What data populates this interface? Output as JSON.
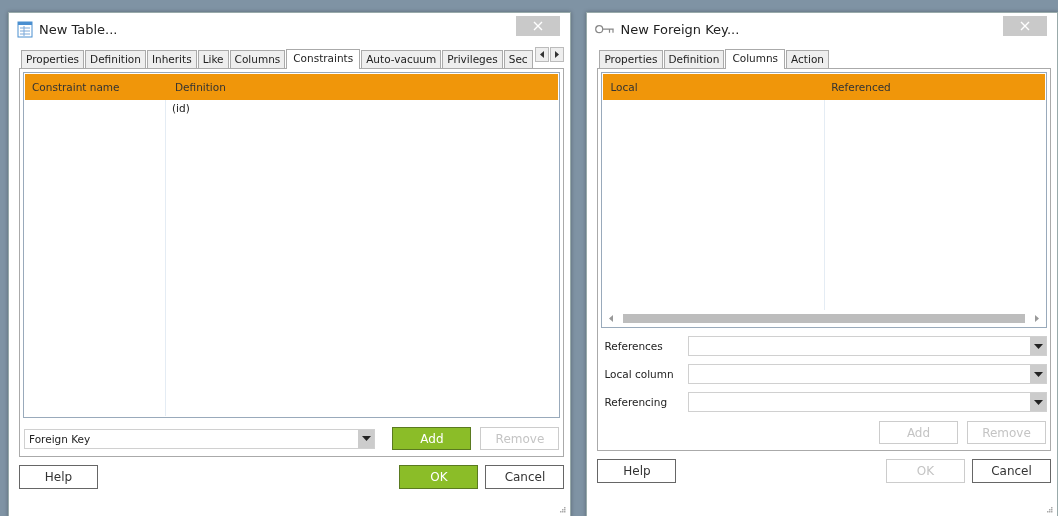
{
  "dialogs": [
    {
      "kind": "table",
      "title": "New Table...",
      "tabs": [
        {
          "label": "Properties",
          "selected": false
        },
        {
          "label": "Definition",
          "selected": false
        },
        {
          "label": "Inherits",
          "selected": false
        },
        {
          "label": "Like",
          "selected": false
        },
        {
          "label": "Columns",
          "selected": false
        },
        {
          "label": "Constraints",
          "selected": true
        },
        {
          "label": "Auto-vacuum",
          "selected": false
        },
        {
          "label": "Privileges",
          "selected": false
        },
        {
          "label": "Sec",
          "selected": false
        }
      ],
      "grid": {
        "columns": [
          "Constraint name",
          "Definition"
        ],
        "rows": [
          [
            "",
            "(id)"
          ]
        ]
      },
      "type_select": {
        "value": "Foreign Key"
      },
      "panel_buttons": [
        {
          "label": "Add",
          "primary": true,
          "disabled": false
        },
        {
          "label": "Remove",
          "primary": false,
          "disabled": true
        }
      ],
      "footer_left": [
        {
          "label": "Help",
          "primary": false,
          "disabled": false
        }
      ],
      "footer_right": [
        {
          "label": "OK",
          "primary": true,
          "disabled": false
        },
        {
          "label": "Cancel",
          "primary": false,
          "disabled": false
        }
      ]
    },
    {
      "kind": "foreign_key",
      "title": "New Foreign Key...",
      "tabs": [
        {
          "label": "Properties",
          "selected": false
        },
        {
          "label": "Definition",
          "selected": false
        },
        {
          "label": "Columns",
          "selected": true
        },
        {
          "label": "Action",
          "selected": false
        }
      ],
      "grid": {
        "columns": [
          "Local",
          "Referenced"
        ]
      },
      "fields": [
        {
          "label": "References"
        },
        {
          "label": "Local column"
        },
        {
          "label": "Referencing"
        }
      ],
      "panel_buttons": [
        {
          "label": "Add",
          "primary": false,
          "disabled": true
        },
        {
          "label": "Remove",
          "primary": false,
          "disabled": true
        }
      ],
      "footer_left": [
        {
          "label": "Help",
          "primary": false,
          "disabled": false
        }
      ],
      "footer_right": [
        {
          "label": "OK",
          "primary": false,
          "disabled": true
        },
        {
          "label": "Cancel",
          "primary": false,
          "disabled": false
        }
      ]
    }
  ]
}
